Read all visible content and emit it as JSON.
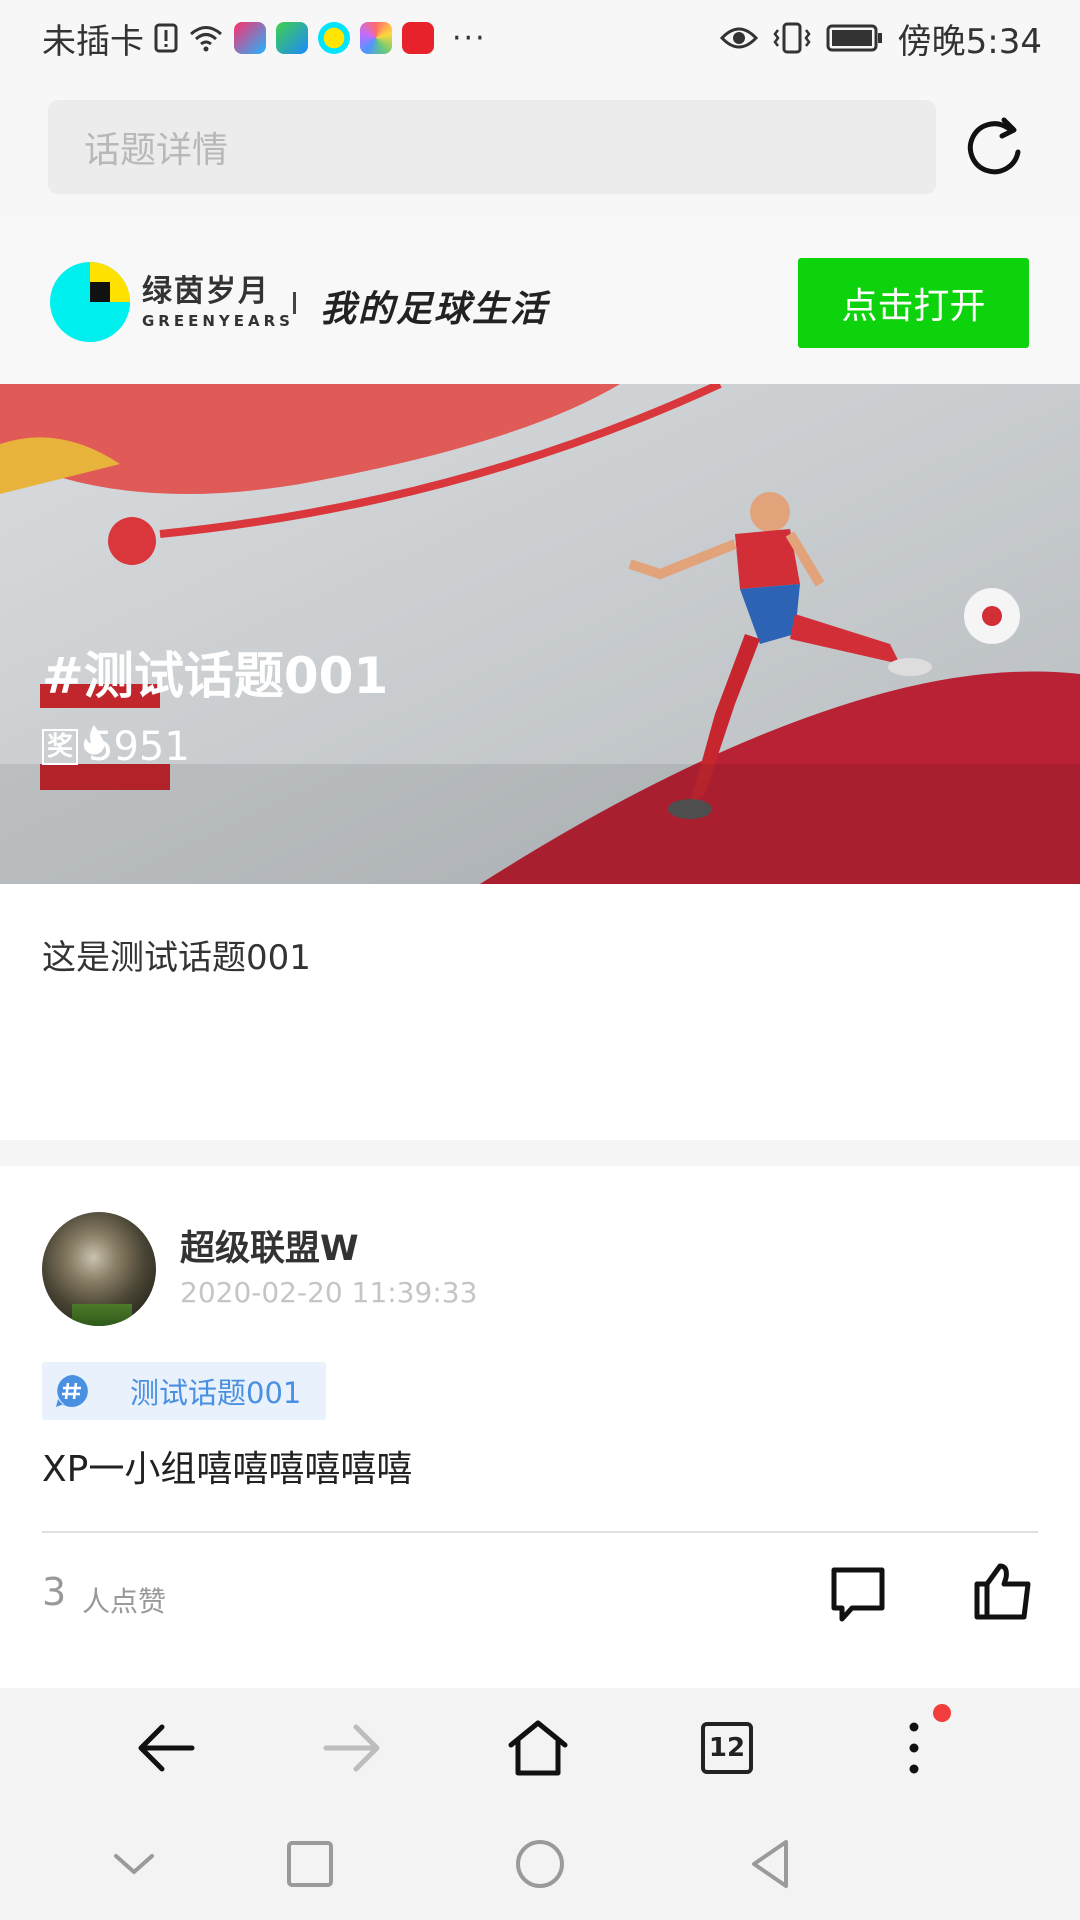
{
  "status_bar": {
    "carrier": "未插卡",
    "more": "···",
    "time": "傍晚5:34"
  },
  "search": {
    "placeholder": "话题详情"
  },
  "app_banner": {
    "brand_name_cn": "绿茵岁月",
    "brand_name_en": "GREENYEARS",
    "slogan": "我的足球生活",
    "open_label": "点击打开"
  },
  "hero": {
    "title": "#测试话题001",
    "award_badge": "奖",
    "hot_count": "5951"
  },
  "topic": {
    "description": "这是测试话题001"
  },
  "post": {
    "username": "超级联盟W",
    "timestamp": "2020-02-20 11:39:33",
    "topic_tag": "测试话题001",
    "text": "XP一小组嘻嘻嘻嘻嘻嘻",
    "like_count": "3",
    "like_suffix": "人点赞"
  },
  "browser_toolbar": {
    "tabs_count": "12"
  },
  "icons": {
    "refresh": "refresh-icon",
    "fire": "fire-icon",
    "hash": "hash-icon",
    "comment": "comment-icon",
    "thumb_up": "thumb-up-icon",
    "back": "back-arrow-icon",
    "forward": "forward-arrow-icon",
    "home": "home-icon",
    "menu": "more-vertical-icon"
  },
  "colors": {
    "open_button": "#0dd30d",
    "topic_tag_bg": "#e8f1fc",
    "topic_tag_text": "#4a90e2",
    "notification_dot": "#f23d3d"
  }
}
